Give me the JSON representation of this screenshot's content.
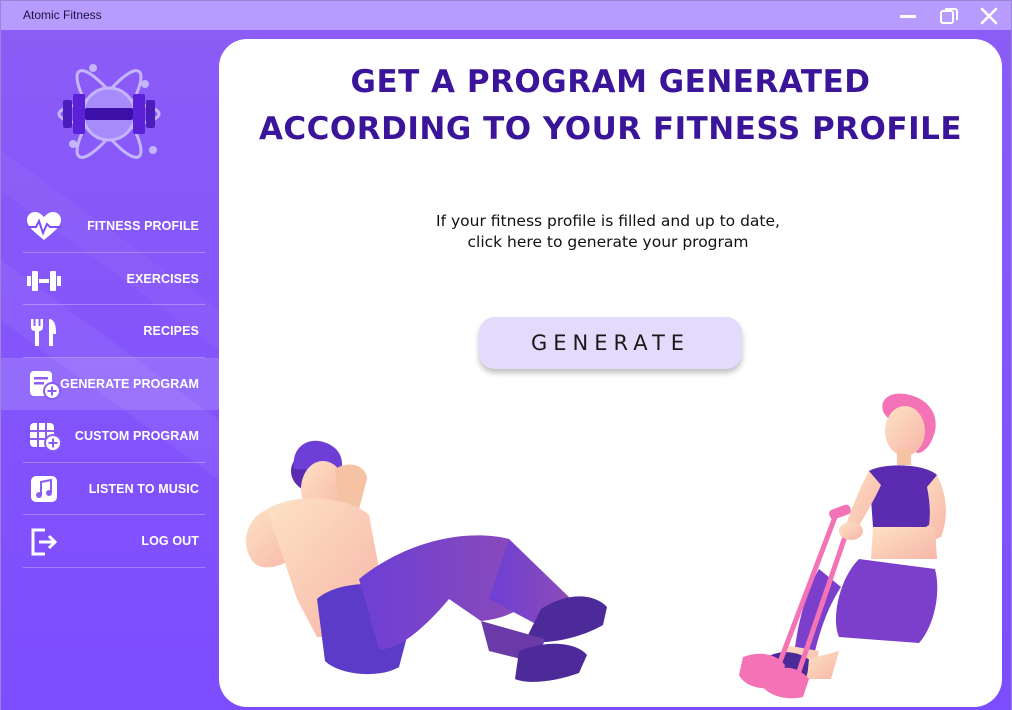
{
  "window": {
    "title": "Atomic Fitness",
    "controls": [
      "minimize-icon",
      "maximize-icon",
      "close-icon"
    ]
  },
  "sidebar": {
    "items": [
      {
        "label": "FITNESS PROFILE",
        "icon": "heart-pulse-icon"
      },
      {
        "label": "EXERCISES",
        "icon": "dumbbell-icon"
      },
      {
        "label": "RECIPES",
        "icon": "fork-knife-icon"
      },
      {
        "label": "GENERATE PROGRAM",
        "icon": "program-add-icon",
        "active": true
      },
      {
        "label": "CUSTOM PROGRAM",
        "icon": "grid-add-icon"
      },
      {
        "label": "LISTEN TO MUSIC",
        "icon": "music-note-icon"
      },
      {
        "label": "LOG OUT",
        "icon": "logout-icon"
      }
    ]
  },
  "main": {
    "headline_line1": "GET A PROGRAM GENERATED",
    "headline_line2": "ACCORDING TO YOUR FITNESS PROFILE",
    "info_line1": "If your fitness profile is filled and up to date,",
    "info_line2": "click here to generate your program",
    "generate_label": "GENERATE"
  },
  "colors": {
    "accent": "#3a1599",
    "sidebar": "#8b5cf6",
    "titlebar": "#b89bff",
    "button": "#e4dafb"
  }
}
